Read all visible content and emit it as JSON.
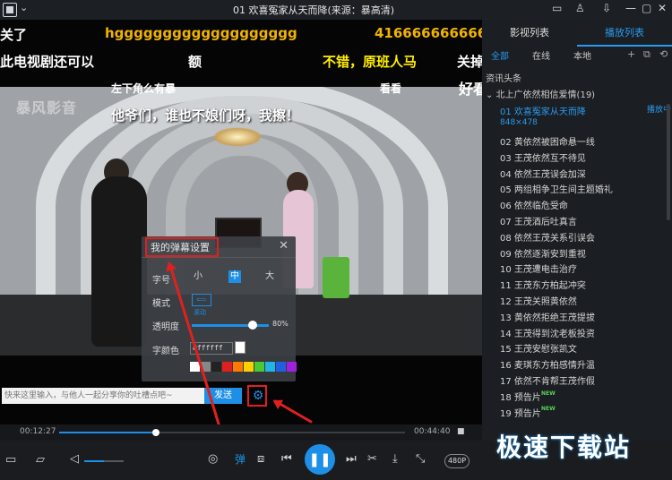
{
  "window": {
    "title": "01 欢喜冤家从天而降(来源：暴高清)",
    "menu_caret": "⌄",
    "controls": [
      "▭",
      "♙",
      "⇩",
      "—",
      "▢",
      "✕"
    ]
  },
  "video": {
    "watermark": "暴风影音",
    "danmaku": [
      {
        "text": "关了",
        "color": "#ffffff"
      },
      {
        "text": "hggggggggggggggggggg",
        "color": "#f0b400"
      },
      {
        "text": "416666666666",
        "color": "#f0b400"
      },
      {
        "text": "此电视剧还可以",
        "color": "#ffffff"
      },
      {
        "text": "额",
        "color": "#ffffff"
      },
      {
        "text": "不错，原班人马",
        "color": "#ffee00"
      },
      {
        "text": "关掉",
        "color": "#ffffff"
      },
      {
        "text": "左下角么有暴",
        "color": "#ffffff"
      },
      {
        "text": "看看",
        "color": "#ffffff"
      },
      {
        "text": "好看",
        "color": "#ffffff"
      },
      {
        "text": "他爷们，谁也不娘们呀，我擦！",
        "color": "#ffffff"
      }
    ]
  },
  "danmaku_settings": {
    "title": "我的弹幕设置",
    "close": "✕",
    "size_label": "字号",
    "size_options": [
      "小",
      "中",
      "大"
    ],
    "size_selected": "中",
    "mode_label": "模式",
    "mode_icon": "⟸",
    "mode_text": "滚动",
    "opacity_label": "透明度",
    "opacity_value": "80%",
    "opacity_fraction": 0.8,
    "color_label": "字颜色",
    "color_value": "#ffffff",
    "swatches": [
      "#ffffff",
      "#888888",
      "#222222",
      "#e02020",
      "#ff7a00",
      "#ffd000",
      "#4cc832",
      "#22b4e6",
      "#2060e0",
      "#a020e0"
    ]
  },
  "input_bar": {
    "placeholder": "快来这里输入，与他人一起分享你的吐槽点吧~",
    "send_label": "发送",
    "gear_icon": "⚙"
  },
  "progress": {
    "elapsed": "00:12:27",
    "total": "00:44:40",
    "fraction": 0.279
  },
  "controls": {
    "open_folder": "▭",
    "open_file": "▱",
    "volume_icon": "◁",
    "volume_fraction": 0.5,
    "mode_icon": "◎",
    "danmaku_button": "弹",
    "eq_icon": "⧈",
    "prev": "⏮",
    "play_pause": "❚❚",
    "next": "⏭",
    "cut": "✂",
    "download": "⤓",
    "fullscreen": "⤡",
    "quality": "480P"
  },
  "sidebar": {
    "tabs": [
      "影视列表",
      "播放列表"
    ],
    "active_tab": "播放列表",
    "subtabs": [
      "全部",
      "在线",
      "本地"
    ],
    "active_subtab": "全部",
    "tools": [
      "+",
      "⧉",
      "⟲"
    ],
    "section": "资讯头条",
    "playlist_header": "⌄ 北上广依然相信爱情(19)",
    "current_resolution": "848×478",
    "playing_label": "播放中",
    "items": [
      "01 欢喜冤家从天而降",
      "02 黄依然被困命悬一线",
      "03 王茂依然互不待见",
      "04 依然王茂误会加深",
      "05 两组相争卫生间主题婚礼",
      "06 依然临危受命",
      "07 王茂酒后吐真言",
      "08 依然王茂关系引误会",
      "09 依然逐渐安到重视",
      "10 王茂遭电击治疗",
      "11 王茂东方柏起冲突",
      "12 王茂关照黄依然",
      "13 黄依然拒绝王茂提拔",
      "14 王茂得到沈老板投资",
      "15 王茂安慰张凯文",
      "16 麦琪东方柏感情升温",
      "17 依然不肯帮王茂作假",
      "18 预告片",
      "19 预告片"
    ],
    "new_badge": "NEW"
  },
  "site_watermark": "极速下载站"
}
